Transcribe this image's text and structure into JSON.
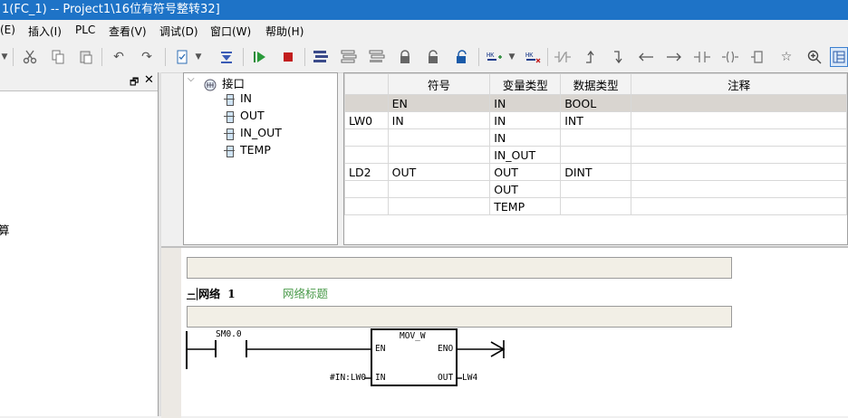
{
  "window": {
    "title": "1(FC_1) -- Project1\\16位有符号整转32]"
  },
  "menu": {
    "items": [
      "(E)",
      "插入(I)",
      "PLC",
      "查看(V)",
      "调试(D)",
      "窗口(W)",
      "帮助(H)"
    ]
  },
  "toolbar": {
    "icons": [
      "dropdown-arrow-icon",
      "cut-icon",
      "copy-icon",
      "paste-icon",
      "undo-icon",
      "redo-icon",
      "new-doc-icon",
      "download-icon",
      "run-icon",
      "stop-icon",
      "compile-icon",
      "compile-all-icon",
      "upload-icon",
      "lock-icon",
      "unlock-icon",
      "unlock-blue-icon",
      "insert-network-icon",
      "delete-network-icon",
      "contact-nc-icon",
      "up-line-icon",
      "down-line-icon",
      "left-line-icon",
      "right-line-icon",
      "contact-icon",
      "coil-icon",
      "box-icon",
      "bookmark-icon",
      "zoom-icon",
      "panel-icon"
    ]
  },
  "tree": {
    "root": "接口",
    "items": [
      "IN",
      "OUT",
      "IN_OUT",
      "TEMP"
    ]
  },
  "var_table": {
    "headers": [
      "",
      "符号",
      "变量类型",
      "数据类型",
      "注释"
    ],
    "rows": [
      [
        "",
        "EN",
        "IN",
        "BOOL",
        ""
      ],
      [
        "LW0",
        "IN",
        "IN",
        "INT",
        ""
      ],
      [
        "",
        "",
        "IN",
        "",
        ""
      ],
      [
        "",
        "",
        "IN_OUT",
        "",
        ""
      ],
      [
        "LD2",
        "OUT",
        "OUT",
        "DINT",
        ""
      ],
      [
        "",
        "",
        "OUT",
        "",
        ""
      ],
      [
        "",
        "",
        "TEMP",
        "",
        ""
      ]
    ]
  },
  "left_panel": {
    "partial_text": "算"
  },
  "network": {
    "collapse": "−",
    "label": "网络",
    "number": "1",
    "title_placeholder": "网络标题",
    "contact": "SM0.0",
    "box_name": "MOV_W",
    "pin_en": "EN",
    "pin_eno": "ENO",
    "pin_in": "IN",
    "pin_out": "OUT",
    "in_operand": "#IN:LW0",
    "out_operand": "LW4"
  }
}
